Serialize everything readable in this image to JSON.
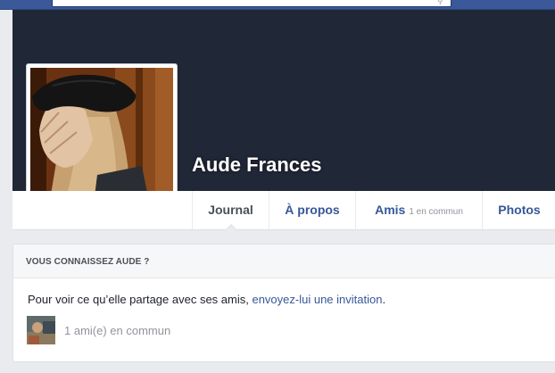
{
  "profile": {
    "name": "Aude Frances"
  },
  "tabs": [
    {
      "label": "Journal"
    },
    {
      "label": "À propos"
    },
    {
      "label": "Amis",
      "count": "1 en commun"
    },
    {
      "label": "Photos"
    }
  ],
  "card": {
    "header": "VOUS CONNAISSEZ AUDE ?",
    "text_prefix": "Pour voir ce qu’elle partage avec ses amis, ",
    "invite_link": "envoyez-lui une invitation",
    "text_suffix": ".",
    "mutual_friends": "1 ami(e) en commun"
  },
  "colors": {
    "topbar": "#3b5998",
    "cover": "#202736",
    "link": "#365899",
    "background": "#e9ebee"
  }
}
